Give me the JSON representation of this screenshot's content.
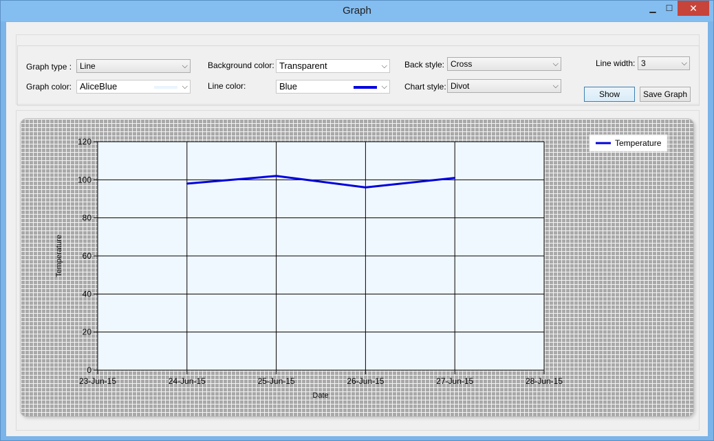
{
  "window": {
    "title": "Graph",
    "min_label": "▁",
    "max_label": "☐",
    "close_label": "✕"
  },
  "controls": {
    "graph_type": {
      "label": "Graph type :",
      "value": "Line"
    },
    "graph_color": {
      "label": "Graph color:",
      "value": "AliceBlue",
      "swatch": "#eaf4fe"
    },
    "background_color": {
      "label": "Background color:",
      "value": "Transparent"
    },
    "line_color": {
      "label": "Line color:",
      "value": "Blue",
      "swatch": "#0000e0"
    },
    "back_style": {
      "label": "Back style:",
      "value": "Cross"
    },
    "chart_style": {
      "label": "Chart style:",
      "value": "Divot"
    },
    "line_width": {
      "label": "Line width:",
      "value": "3"
    },
    "show_button": "Show",
    "save_button": "Save Graph"
  },
  "colors": {
    "plot_bg": "#f0f8ff",
    "series": "#0000dd",
    "hatch": "#a9a9a9"
  },
  "chart_data": {
    "type": "line",
    "xlabel": "Date",
    "ylabel": "Temperature",
    "x_ticks": [
      "23-Jun-15",
      "24-Jun-15",
      "25-Jun-15",
      "26-Jun-15",
      "27-Jun-15",
      "28-Jun-15"
    ],
    "y_ticks": [
      "0",
      "20",
      "40",
      "60",
      "80",
      "100",
      "120"
    ],
    "ylim": [
      0,
      120
    ],
    "grid": true,
    "legend_position": "top-right",
    "series": [
      {
        "name": "Temperature",
        "x": [
          "24-Jun-15",
          "25-Jun-15",
          "26-Jun-15",
          "27-Jun-15"
        ],
        "values": [
          98,
          102,
          96,
          101
        ]
      }
    ]
  }
}
